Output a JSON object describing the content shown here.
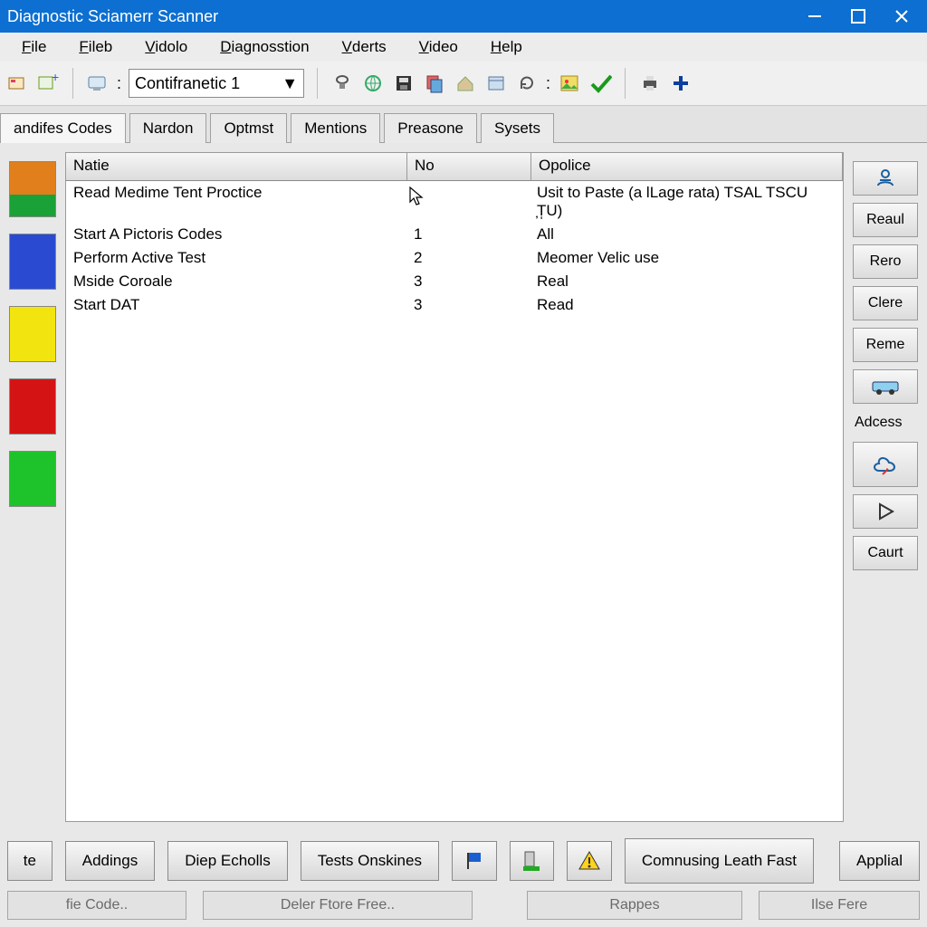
{
  "window": {
    "title": "Diagnostic Sciamerr Scanner"
  },
  "menu": {
    "file": "File",
    "fileb": "Fileb",
    "vidolo": "Vidolo",
    "diag": "Diagnosstion",
    "vderts": "Vderts",
    "video": "Video",
    "help": "Help"
  },
  "toolbar": {
    "combo_value": "Contifranetic 1"
  },
  "tabs": {
    "t0": "andifes Codes",
    "t1": "Nardon",
    "t2": "Optmst",
    "t3": "Mentions",
    "t4": "Preasone",
    "t5": "Sysets"
  },
  "table": {
    "h1": "Natie",
    "h2": "No",
    "h3": "Opolice",
    "rows": [
      {
        "c1": "Read Medime Tent Proctice",
        "c2": "",
        "c3": "Usit to Paste (a lLage rata) TSAL TSCU ̦T̩U)"
      },
      {
        "c1": "Start A Pictoris Codes",
        "c2": "1",
        "c3": "All"
      },
      {
        "c1": "Perform Active Test",
        "c2": "2",
        "c3": "Meomer Velic use"
      },
      {
        "c1": "Mside Coroale",
        "c2": "3",
        "c3": "Real"
      },
      {
        "c1": "Start DAT",
        "c2": "3",
        "c3": "Read"
      }
    ]
  },
  "right": {
    "b0": "Reaul",
    "b1": "Rero",
    "b2": "Clere",
    "b3": "Reme",
    "label": "Adcess",
    "b4": "Caurt"
  },
  "bottom1": {
    "b0": "te",
    "b1": "Addings",
    "b2": "Diep Echolls",
    "b3": "Tests Onskines",
    "b4": "Comnusing Leath Fast",
    "b5": "Applial"
  },
  "bottom2": {
    "b0": "fie Code..",
    "b1": "Deler Ftore Free..",
    "b2": "Rappes",
    "b3": "Ilse Fere"
  }
}
